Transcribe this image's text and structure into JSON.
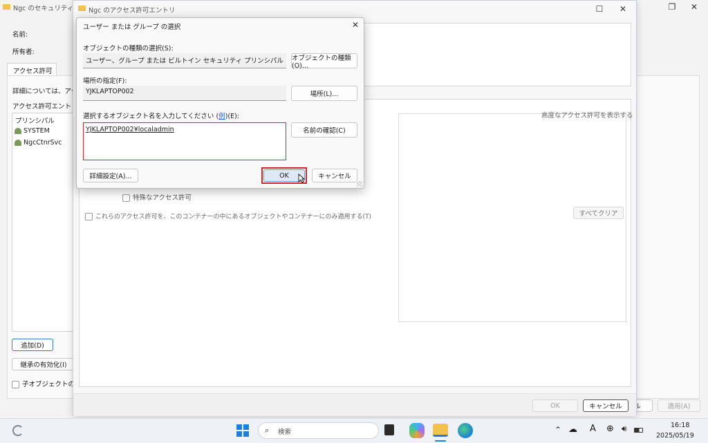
{
  "back_window": {
    "title": "Ngc のセキュリティの詳",
    "name_label": "名前:",
    "owner_label": "所有者:",
    "tab": "アクセス許可",
    "detail_text": "詳細については、アク",
    "entries_label": "アクセス許可エントリ",
    "principal_header": "プリンシパル",
    "principals": [
      "SYSTEM",
      "NgcCtnrSvc"
    ],
    "add_button": "追加(D)",
    "inherit_button": "継承の有効化(I)",
    "child_checkbox": "子オブジェクトのア",
    "partial_button": "ル",
    "apply_button": "適用(A)"
  },
  "middle_window": {
    "title": "Ngc のアクセス許可エントリ",
    "advanced_link": "高度なアクセス許可を表示する",
    "special_permission": "特殊なアクセス許可",
    "apply_only_checkbox": "これらのアクセス許可を、このコンテナーの中にあるオブジェクトやコンテナーにのみ適用する(T)",
    "clear_all_button": "すべてクリア",
    "ok_button": "OK",
    "cancel_button": "キャンセル"
  },
  "dialog": {
    "title": "ユーザー または グループ の選択",
    "object_type_label": "オブジェクトの種類の選択(S):",
    "object_type_value": "ユーザー、グループ または ビルトイン セキュリティ プリンシパル",
    "object_type_button": "オブジェクトの種類(O)...",
    "location_label": "場所の指定(F):",
    "location_value": "YJKLAPTOP002",
    "location_button": "場所(L)...",
    "enter_label_prefix": "選択するオブジェクト名を入力してください (",
    "enter_label_link": "例",
    "enter_label_suffix": ")(E):",
    "object_name_value": "YJKLAPTOP002¥localadmin",
    "check_names_button": "名前の確認(C)",
    "advanced_button": "詳細設定(A)...",
    "ok_button": "OK",
    "cancel_button": "キャンセル"
  },
  "taskbar": {
    "search_placeholder": "検索",
    "time": "16:18",
    "date": "2025/05/19",
    "ime": "A"
  },
  "colors": {
    "highlight_red": "#d1262b",
    "link_blue": "#1f5fbf"
  }
}
